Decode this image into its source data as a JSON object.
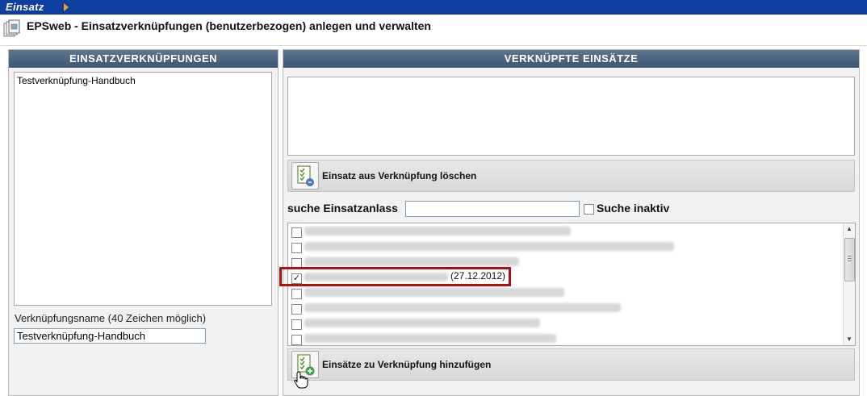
{
  "topbar": {
    "brand": "Einsatz"
  },
  "title": "EPSweb - Einsatzverknüpfungen (benutzerbezogen) anlegen und verwalten",
  "left_panel": {
    "header": "EINSATZVERKNÜPFUNGEN",
    "items": [
      "Testverknüpfung-Handbuch"
    ],
    "name_label": "Verknüpfungsname (40 Zeichen möglich)",
    "name_value": "Testverknüpfung-Handbuch"
  },
  "right_panel": {
    "header": "VERKNÜPFTE EINSÄTZE",
    "delete_button": "Einsatz aus Verknüpfung löschen",
    "search_label": "suche Einsatzanlass",
    "search_value": "",
    "inactive_label": "Suche inaktiv",
    "add_button": "Einsätze zu Verknüpfung hinzufügen",
    "results": [
      {
        "checked": false,
        "date": ""
      },
      {
        "checked": false,
        "date": ""
      },
      {
        "checked": false,
        "date": ""
      },
      {
        "checked": true,
        "date": "(27.12.2012)"
      },
      {
        "checked": false,
        "date": ""
      },
      {
        "checked": false,
        "date": ""
      },
      {
        "checked": false,
        "date": ""
      },
      {
        "checked": false,
        "date": ""
      }
    ]
  },
  "colors": {
    "topbar": "#0c3fa0",
    "panel_header": "#4f667f",
    "highlight": "#b01010",
    "arrow": "#f0a020"
  }
}
